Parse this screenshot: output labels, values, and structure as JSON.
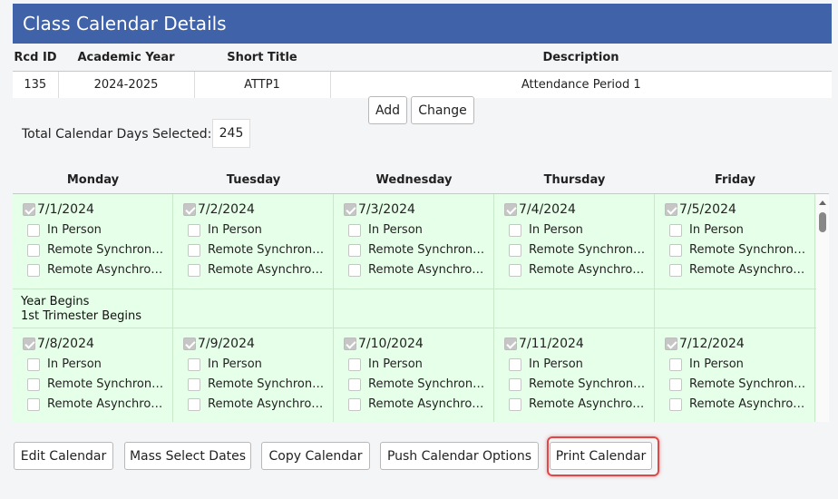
{
  "page": {
    "title": "Class Calendar Details"
  },
  "details": {
    "headers": [
      "Rcd ID",
      "Academic Year",
      "Short Title",
      "Description"
    ],
    "row": [
      "135",
      "2024-2025",
      "ATTP1",
      "Attendance Period 1"
    ]
  },
  "actions": {
    "add": "Add",
    "change": "Change"
  },
  "total": {
    "label": "Total Calendar Days Selected:",
    "value": "245"
  },
  "calendar": {
    "days": [
      "Monday",
      "Tuesday",
      "Wednesday",
      "Thursday",
      "Friday"
    ],
    "options": [
      "In Person",
      "Remote Synchronous",
      "Remote Asynchronous"
    ],
    "weeks": [
      {
        "dates": [
          "7/1/2024",
          "7/2/2024",
          "7/3/2024",
          "7/4/2024",
          "7/5/2024"
        ],
        "notes": [
          "Year Begins\n1st Trimester Begins",
          "",
          "",
          "",
          ""
        ]
      },
      {
        "dates": [
          "7/8/2024",
          "7/9/2024",
          "7/10/2024",
          "7/11/2024",
          "7/12/2024"
        ],
        "notes": [
          "",
          "",
          "",
          "",
          ""
        ]
      }
    ]
  },
  "footer": {
    "edit": "Edit Calendar",
    "mass": "Mass Select Dates",
    "copy": "Copy Calendar",
    "push": "Push Calendar Options",
    "print": "Print Calendar"
  },
  "colors": {
    "header": "#4062a8",
    "cell": "#e6ffe8",
    "highlight": "#e04848"
  }
}
